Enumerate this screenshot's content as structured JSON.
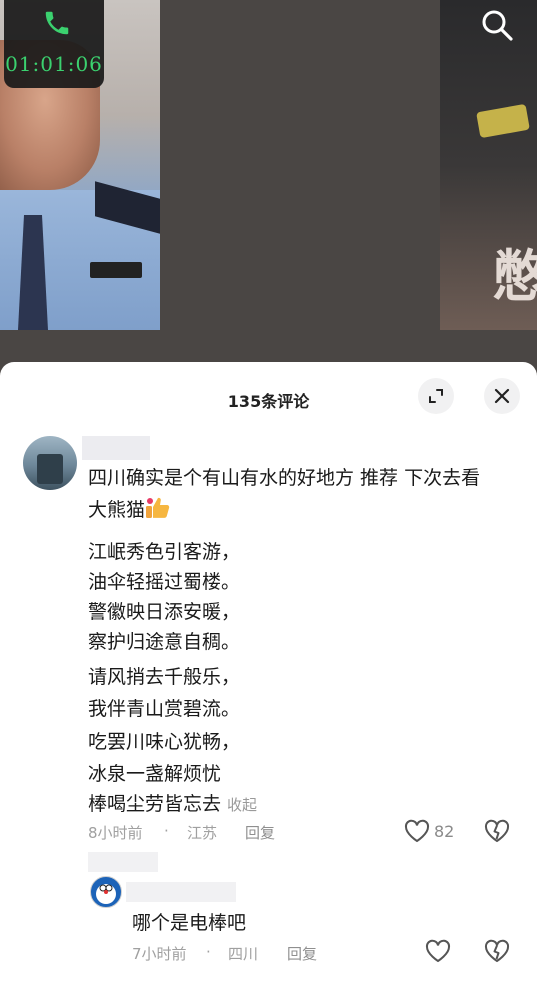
{
  "call": {
    "timer": "01:01:06",
    "icon": "phone-icon",
    "accent_color": "#3bd16f"
  },
  "video": {
    "right_caption_char": "憋"
  },
  "comments_panel": {
    "title": "135条评论",
    "expand_icon": "expand-icon",
    "close_icon": "close-icon"
  },
  "comments": [
    {
      "text_line1": "四川确实是个有山有水的好地方  推荐  下次去看",
      "text_line2": "大熊猫",
      "emoji": "thumbs-up-icon",
      "poem": [
        "江岷秀色引客游，",
        "油伞轻摇过蜀楼。",
        "警徽映日添安暖，",
        "察护归途意自稠。",
        "请风捎去千般乐，",
        "我伴青山赏碧流。",
        "吃罢川味心犹畅，",
        "冰泉一盏解烦忧",
        "棒喝尘劳皆忘去"
      ],
      "collapse_label": "收起",
      "time": "8小时前",
      "separator": "·",
      "location": "江苏",
      "reply_label": "回复",
      "likes": "82"
    }
  ],
  "reply": {
    "text": "哪个是电棒吧",
    "time": "7小时前",
    "separator": "·",
    "location": "四川",
    "reply_label": "回复"
  }
}
